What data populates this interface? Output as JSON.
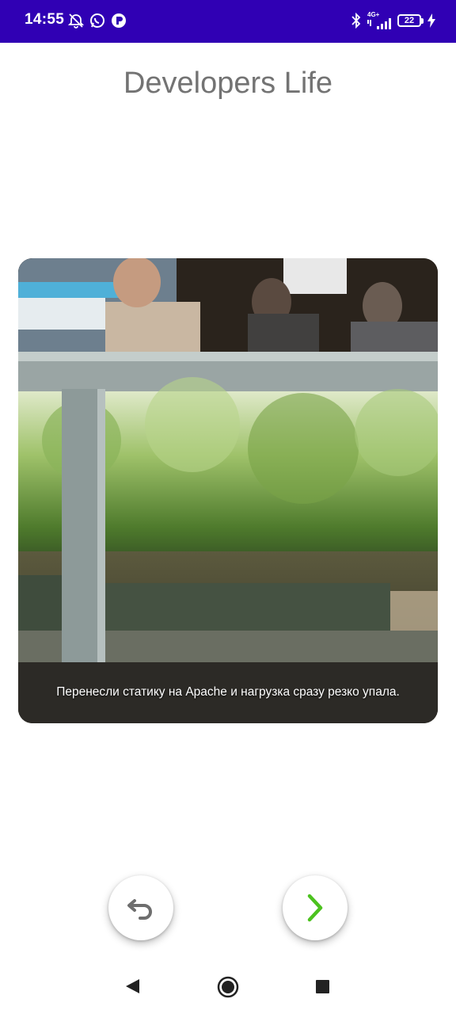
{
  "status_bar": {
    "time": "14:55",
    "network_label": "4G+",
    "battery_level": "22",
    "icons": [
      "alarm-off-icon",
      "whatsapp-icon",
      "app-notification-icon",
      "bluetooth-icon",
      "signal-icon",
      "battery-icon",
      "charging-icon"
    ],
    "background_color": "#3000b4"
  },
  "app": {
    "title": "Developers Life"
  },
  "post": {
    "caption": "Перенесли статику на Apache и нагрузка сразу резко упала."
  },
  "controls": {
    "back_icon": "undo-icon",
    "next_icon": "chevron-right-icon",
    "next_color": "#4cc21f",
    "back_color": "#6e6e6e"
  },
  "navigation": {
    "icons": [
      "nav-back-icon",
      "nav-home-icon",
      "nav-recents-icon"
    ]
  }
}
